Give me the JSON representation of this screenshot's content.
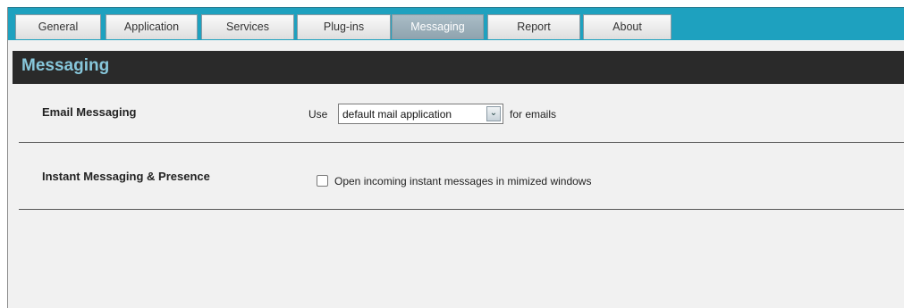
{
  "tabs": [
    {
      "label": "General"
    },
    {
      "label": "Application"
    },
    {
      "label": "Services"
    },
    {
      "label": "Plug-ins"
    },
    {
      "label": "Messaging",
      "active": true
    },
    {
      "label": "Report"
    },
    {
      "label": "About"
    }
  ],
  "page": {
    "title": "Messaging"
  },
  "email": {
    "section_label": "Email Messaging",
    "use_label": "Use",
    "mail_app_value": "default mail application",
    "suffix": "for emails"
  },
  "im": {
    "section_label": "Instant Messaging & Presence",
    "checkbox_label": "Open incoming instant messages in mimized windows",
    "checked": false
  },
  "colors": {
    "tabbar": "#1ea1bf",
    "header_bg": "#2a2a2a",
    "title": "#87c7db"
  }
}
